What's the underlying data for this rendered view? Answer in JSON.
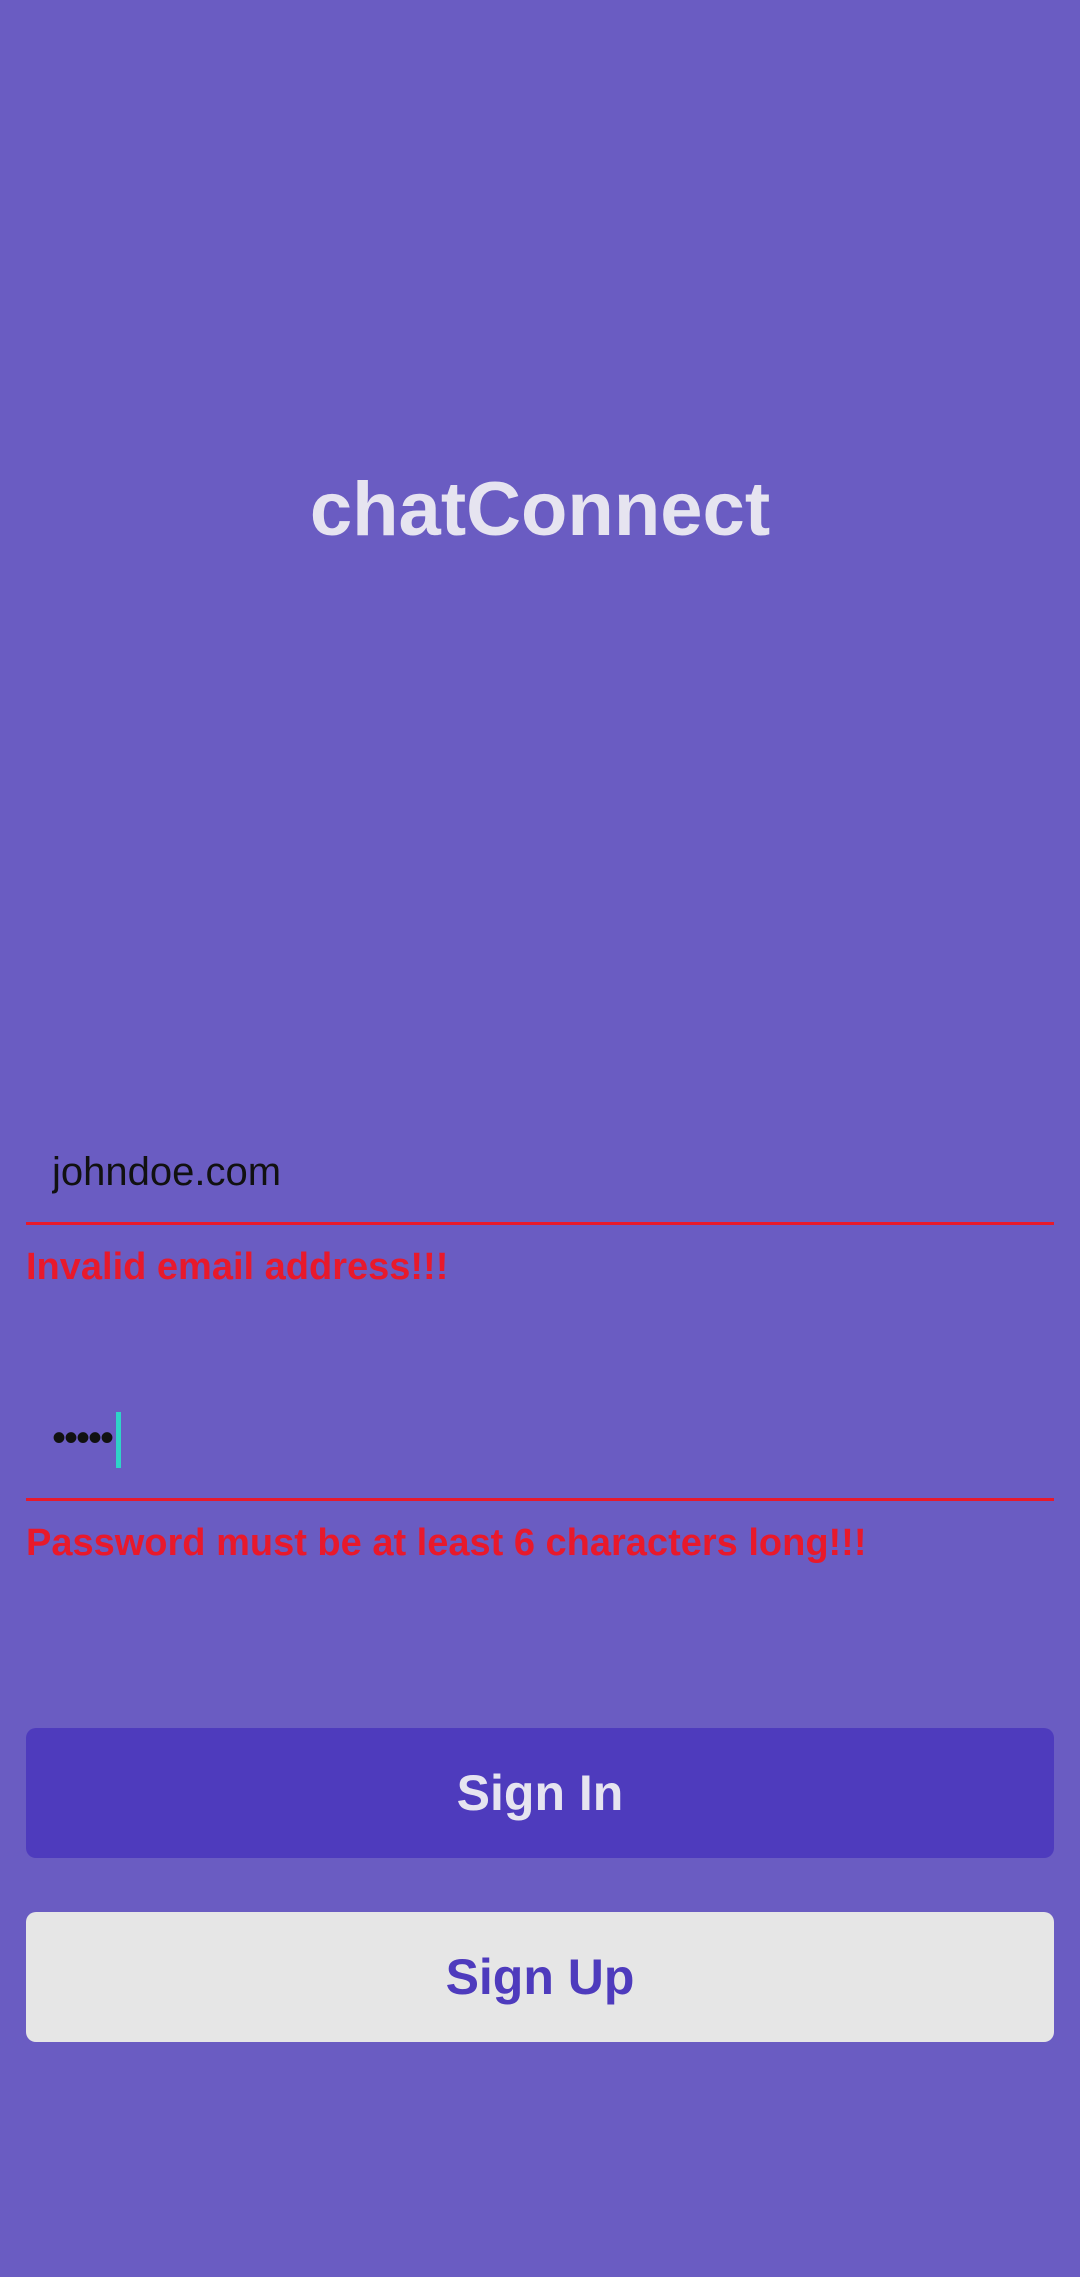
{
  "app": {
    "title": "chatConnect"
  },
  "login_form": {
    "email": {
      "value": "johndoe.com",
      "error": "Invalid email address!!!"
    },
    "password": {
      "masked_value": "•••••",
      "error": "Password must be at least 6 characters long!!!"
    },
    "sign_in_label": "Sign In",
    "sign_up_label": "Sign Up"
  },
  "colors": {
    "background": "#6a5cc2",
    "primary_button": "#4e3bbd",
    "secondary_button": "#e6e6e6",
    "error": "#e8192b",
    "cursor": "#2fd3c8",
    "title_text": "#e6e4f0"
  }
}
